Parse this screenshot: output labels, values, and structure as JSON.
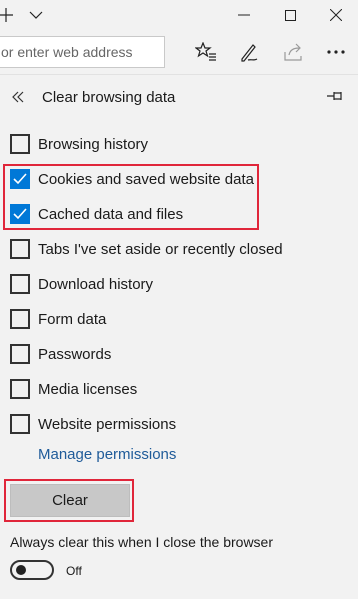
{
  "titlebar": {
    "new_tab_icon": "plus-icon",
    "tab_menu_icon": "chevron-down-icon",
    "minimize_icon": "minimize-icon",
    "maximize_icon": "maximize-icon",
    "close_icon": "close-icon"
  },
  "addressbar": {
    "placeholder": "or enter web address",
    "tools": [
      "favorites-star-icon",
      "pen-icon",
      "share-icon",
      "more-icon"
    ]
  },
  "panel": {
    "title": "Clear browsing data",
    "back_icon": "double-chevron-left-icon",
    "pin_icon": "pin-icon",
    "items": [
      {
        "label": "Browsing history",
        "checked": false
      },
      {
        "label": "Cookies and saved website data",
        "checked": true
      },
      {
        "label": "Cached data and files",
        "checked": true
      },
      {
        "label": "Tabs I've set aside or recently closed",
        "checked": false
      },
      {
        "label": "Download history",
        "checked": false
      },
      {
        "label": "Form data",
        "checked": false
      },
      {
        "label": "Passwords",
        "checked": false
      },
      {
        "label": "Media licenses",
        "checked": false
      },
      {
        "label": "Website permissions",
        "checked": false
      }
    ],
    "manage_link": "Manage permissions",
    "clear_button": "Clear",
    "always_clear_label": "Always clear this when I close the browser",
    "toggle_state": "Off",
    "highlight_color": "#e0263a",
    "accent_color": "#0078d7"
  }
}
